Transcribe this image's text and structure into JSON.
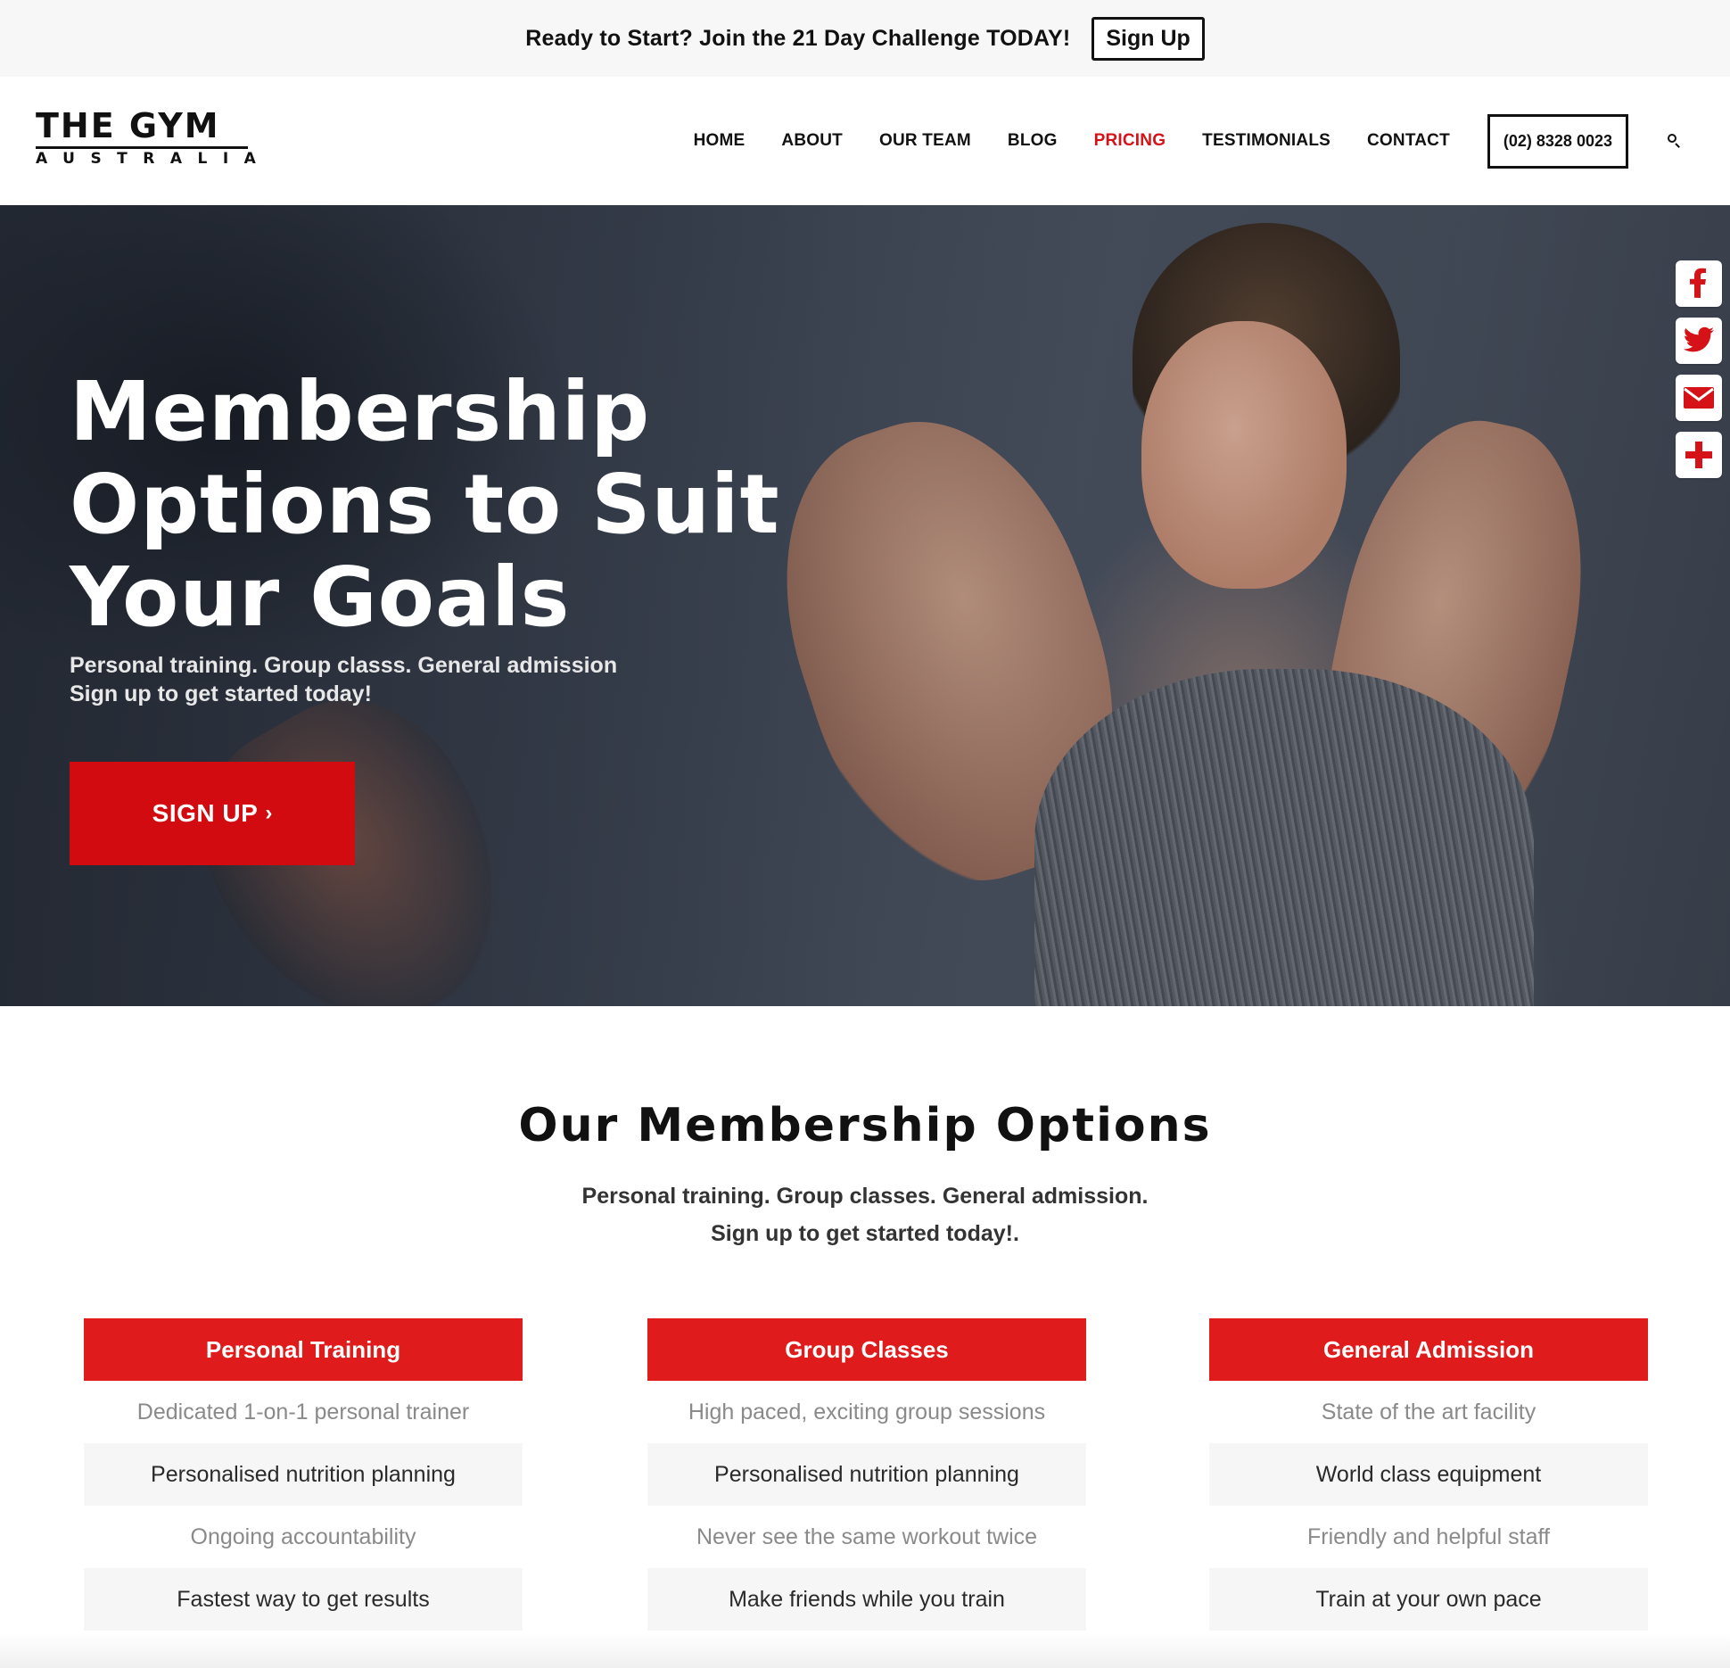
{
  "announcement": {
    "text": "Ready to Start? Join the 21 Day Challenge TODAY!",
    "button_label": "Sign Up"
  },
  "logo": {
    "line1": "THE GYM",
    "line2": "AUSTRALIA"
  },
  "nav": {
    "items": [
      {
        "label": "HOME",
        "active": false
      },
      {
        "label": "ABOUT",
        "active": false
      },
      {
        "label": "OUR TEAM",
        "active": false
      },
      {
        "label": "BLOG",
        "active": false
      },
      {
        "label": "PRICING",
        "active": true
      },
      {
        "label": "TESTIMONIALS",
        "active": false
      },
      {
        "label": "CONTACT",
        "active": false
      }
    ],
    "phone": "(02) 8328 0023",
    "search_icon": "search-icon",
    "active_color": "#d51217"
  },
  "hero": {
    "title": "Membership Options to Suit Your Goals",
    "subtitle_line1": "Personal training. Group classs. General admission",
    "subtitle_line2": "Sign up to get started today!",
    "button_label": "SIGN UP",
    "button_chevron": "›",
    "button_color": "#d10b0f"
  },
  "share": {
    "icons": [
      "facebook-icon",
      "twitter-icon",
      "email-icon",
      "plus-icon"
    ],
    "color": "#d51217"
  },
  "options": {
    "title": "Our Membership Options",
    "subtitle_line1": "Personal training. Group classes. General admission.",
    "subtitle_line2": "Sign up to get started today!.",
    "header_color": "#e01b1b",
    "plans": [
      {
        "name": "Personal Training",
        "features": [
          "Dedicated 1-on-1 personal trainer",
          "Personalised nutrition planning",
          "Ongoing accountability",
          "Fastest way to get results"
        ]
      },
      {
        "name": "Group Classes",
        "features": [
          "High paced, exciting group sessions",
          "Personalised nutrition planning",
          "Never see the same workout twice",
          "Make friends while you train"
        ]
      },
      {
        "name": "General Admission",
        "features": [
          "State of the art facility",
          "World class equipment",
          "Friendly and helpful staff",
          "Train at your own pace"
        ]
      }
    ]
  }
}
